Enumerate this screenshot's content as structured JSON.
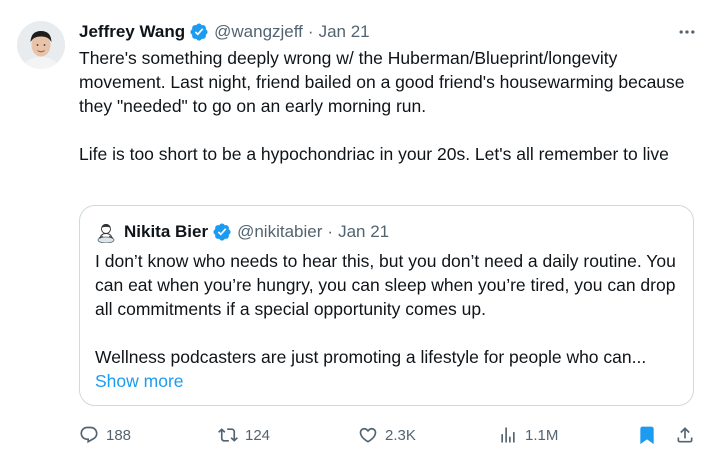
{
  "author": {
    "name": "Jeffrey Wang",
    "handle": "@wangzjeff",
    "separator": "·",
    "date": "Jan 21"
  },
  "tweet": {
    "paragraph1": "There's something deeply wrong w/ the Huberman/Blueprint/longevity movement. Last night, friend bailed on a good friend's housewarming because they \"needed\" to go on an early morning run.",
    "paragraph2": "Life is too short to be a hypochondriac in your 20s. Let's all remember to live"
  },
  "quoted": {
    "name": "Nikita Bier",
    "handle": "@nikitabier",
    "separator": "·",
    "date": "Jan 21",
    "paragraph1": "I don’t know who needs to hear this, but you don’t need a daily routine. You can eat when you’re hungry, you can sleep when you’re tired, you can drop all commitments if a special opportunity comes up.",
    "paragraph2": "Wellness podcasters are just promoting a lifestyle for people who can...",
    "show_more": "Show more"
  },
  "actions": {
    "replies": "188",
    "reposts": "124",
    "likes": "2.3K",
    "views": "1.1M"
  },
  "icons": {
    "verified": "verified-badge-icon",
    "more": "more-icon",
    "reply": "reply-icon",
    "repost": "repost-icon",
    "like": "heart-icon",
    "views": "views-icon",
    "bookmark": "bookmark-icon",
    "share": "share-icon"
  },
  "colors": {
    "verified": "#1d9bf0",
    "link": "#1d9bf0",
    "bookmark_active": "#1d9bf0",
    "muted": "#536471",
    "border": "#cfd9de"
  }
}
